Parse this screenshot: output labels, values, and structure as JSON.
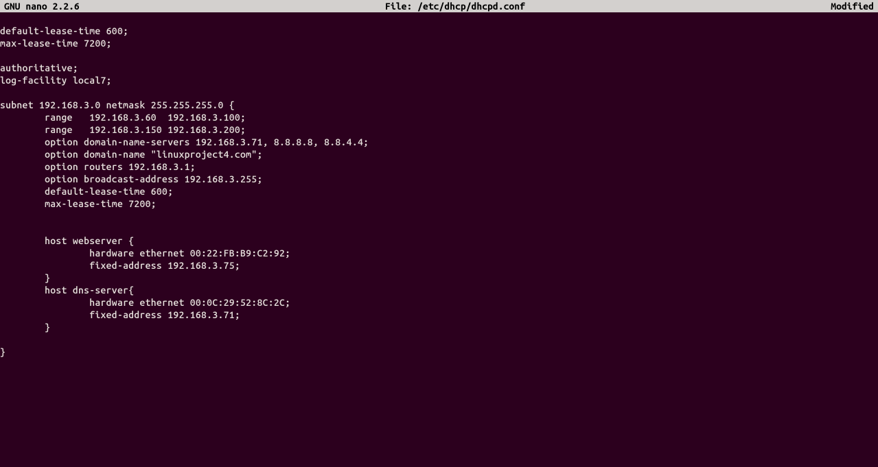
{
  "titlebar": {
    "app_name": "GNU nano 2.2.6",
    "file_label": "File: /etc/dhcp/dhcpd.conf",
    "status": "Modified"
  },
  "lines": [
    "",
    "default-lease-time 600;",
    "max-lease-time 7200;",
    "",
    "authoritative;",
    "log-facility local7;",
    "",
    "subnet 192.168.3.0 netmask 255.255.255.0 {",
    "        range   192.168.3.60  192.168.3.100;",
    "        range   192.168.3.150 192.168.3.200;",
    "        option domain-name-servers 192.168.3.71, 8.8.8.8, 8.8.4.4;",
    "        option domain-name \"linuxproject4.com\";",
    "        option routers 192.168.3.1;",
    "        option broadcast-address 192.168.3.255;",
    "        default-lease-time 600;",
    "        max-lease-time 7200;",
    "",
    "",
    "        host webserver {",
    "                hardware ethernet 00:22:FB:B9:C2:92;",
    "                fixed-address 192.168.3.75;",
    "        }",
    "        host dns-server{",
    "                hardware ethernet 00:0C:29:52:8C:2C;",
    "                fixed-address 192.168.3.71;",
    "        }",
    "",
    "}"
  ]
}
